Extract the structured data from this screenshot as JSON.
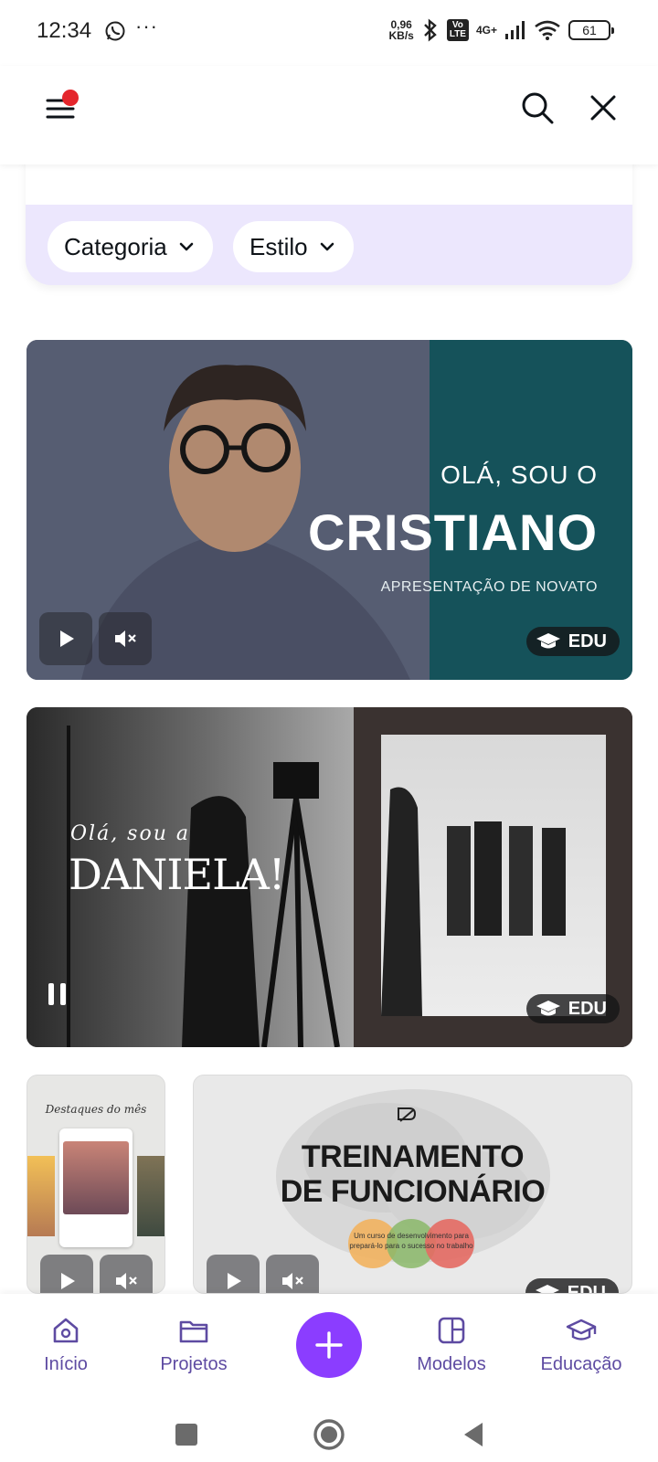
{
  "status_bar": {
    "time": "12:34",
    "more": "···",
    "speed_value": "0,96",
    "speed_unit": "KB/s",
    "volte_top": "Vo",
    "volte_bottom": "LTE",
    "network": "4G+",
    "battery": "61"
  },
  "header": {
    "menu_icon": "hamburger-menu-icon",
    "search_icon": "search-icon",
    "close_icon": "close-icon",
    "notification_color": "#e4262c"
  },
  "filters": {
    "category_label": "Categoria",
    "style_label": "Estilo"
  },
  "cards": [
    {
      "hello": "OLÁ, SOU O",
      "name": "CRISTIANO",
      "subtitle": "APRESENTAÇÃO DE NOVATO",
      "badge": "EDU"
    },
    {
      "hello": "Olá, sou a",
      "name": "DANIELA!",
      "badge": "EDU"
    },
    {
      "title": "Destaques do mês"
    },
    {
      "title_line1": "TREINAMENTO",
      "title_line2": "DE FUNCIONÁRIO",
      "note": "Um curso de desenvolvimento para prepará-lo para o sucesso no trabalho",
      "badge": "EDU"
    }
  ],
  "bottom_nav": {
    "home": "Início",
    "projects": "Projetos",
    "templates": "Modelos",
    "education": "Educação"
  },
  "colors": {
    "accent": "#8b3dff",
    "nav_text": "#5e4ba2",
    "filter_panel": "#ece7fd",
    "card1_teal": "#15525a"
  }
}
